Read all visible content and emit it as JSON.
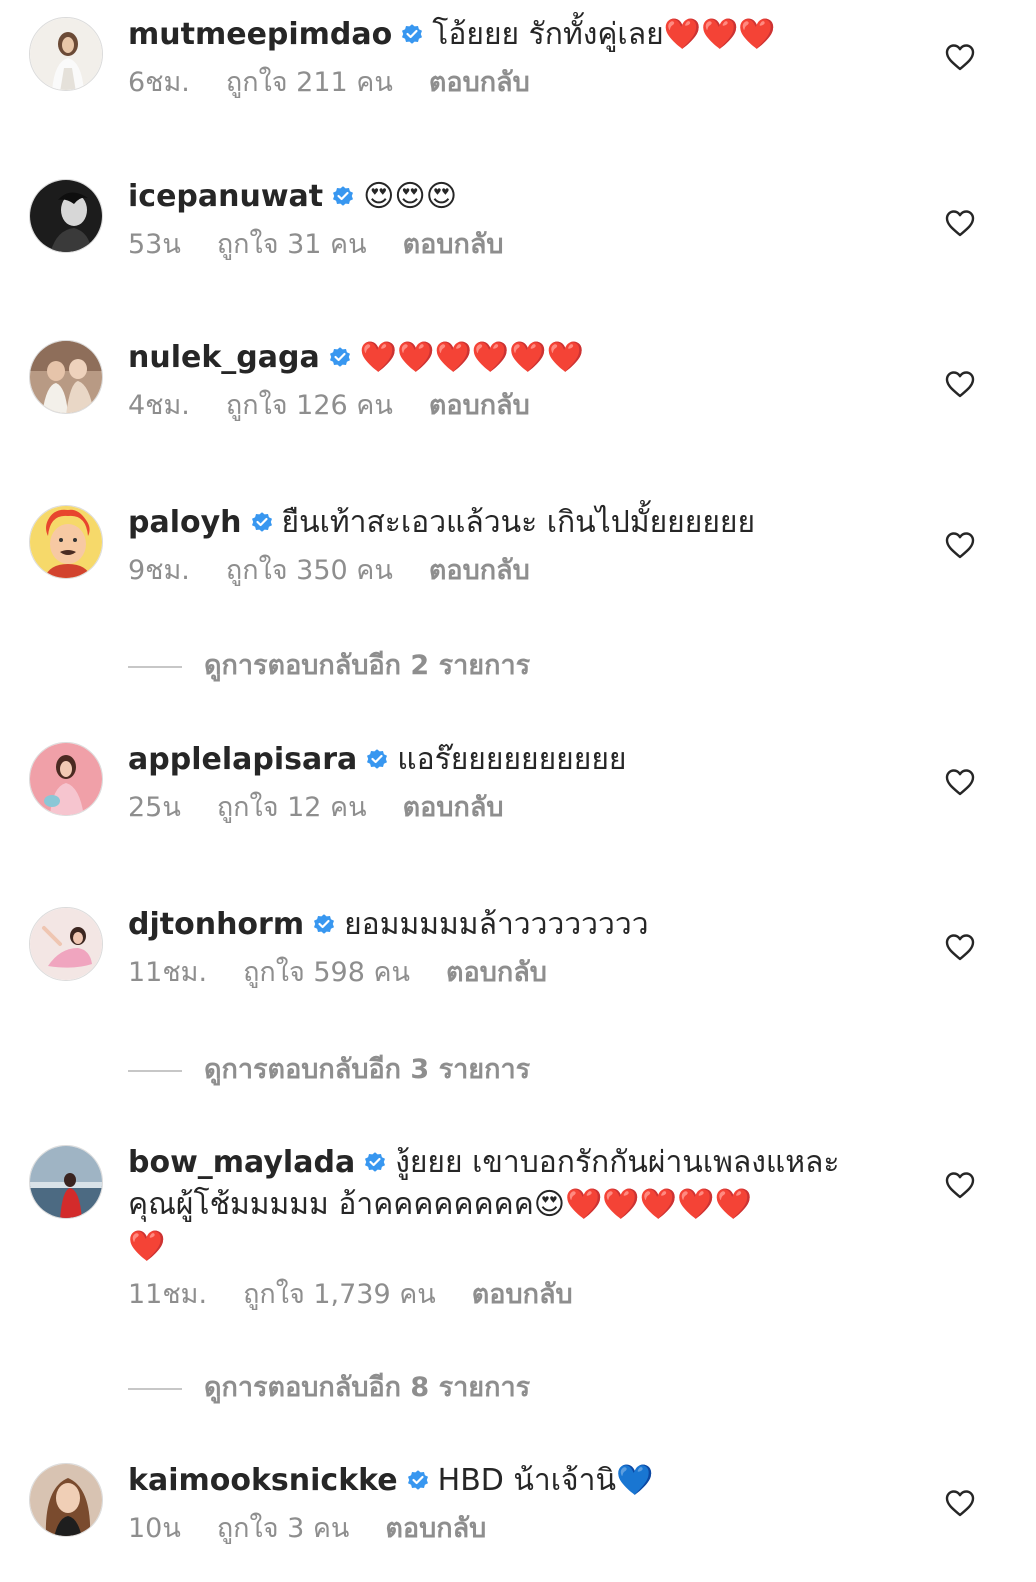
{
  "colors": {
    "text": "#262626",
    "secondary": "#8e8e8e",
    "verified": "#3897f0",
    "heart_emoji": "#e0243a",
    "blue_heart_emoji": "#2f7be8"
  },
  "comments": [
    {
      "username": "mutmeepimdao",
      "text": "โอ้ยยย รักทั้งคู่เลย❤️❤️❤️",
      "time": "6ชม.",
      "likes": "ถูกใจ 211 คน",
      "reply": "ตอบกลับ"
    },
    {
      "username": "icepanuwat",
      "text": "😍😍😍",
      "time": "53น",
      "likes": "ถูกใจ 31 คน",
      "reply": "ตอบกลับ"
    },
    {
      "username": "nulek_gaga",
      "text": "❤️❤️❤️❤️❤️❤️",
      "time": "4ชม.",
      "likes": "ถูกใจ 126 คน",
      "reply": "ตอบกลับ"
    },
    {
      "username": "paloyh",
      "text": "ยืนเท้าสะเอวแล้วนะ เกินไปมั้ยยยยยย",
      "time": "9ชม.",
      "likes": "ถูกใจ 350 คน",
      "reply": "ตอบกลับ",
      "more_replies": "ดูการตอบกลับอีก 2 รายการ"
    },
    {
      "username": "applelapisara",
      "text": "แอร๊ยยยยยยยยยย",
      "time": "25น",
      "likes": "ถูกใจ 12 คน",
      "reply": "ตอบกลับ"
    },
    {
      "username": "djtonhorm",
      "text": "ยอมมมมมล้าวววววววว",
      "time": "11ชม.",
      "likes": "ถูกใจ 598 คน",
      "reply": "ตอบกลับ",
      "more_replies": "ดูการตอบกลับอีก 3 รายการ"
    },
    {
      "username": "bow_maylada",
      "text_line1": "งู้ยยย เขาบอกรักกันผ่านเพลงแหละ",
      "text_line2": "คุณผู้โช้มมมมม อ้าคคคคคคคค😍❤️❤️❤️❤️❤️",
      "text_line3": "❤️",
      "time": "11ชม.",
      "likes": "ถูกใจ 1,739 คน",
      "reply": "ตอบกลับ",
      "more_replies": "ดูการตอบกลับอีก 8 รายการ"
    },
    {
      "username": "kaimooksnickke",
      "text": "HBD น้าเจ้านิ💙",
      "time": "10น",
      "likes": "ถูกใจ 3 คน",
      "reply": "ตอบกลับ"
    }
  ],
  "icons": {
    "verified": "verified-badge-icon",
    "like": "heart-outline-icon"
  }
}
